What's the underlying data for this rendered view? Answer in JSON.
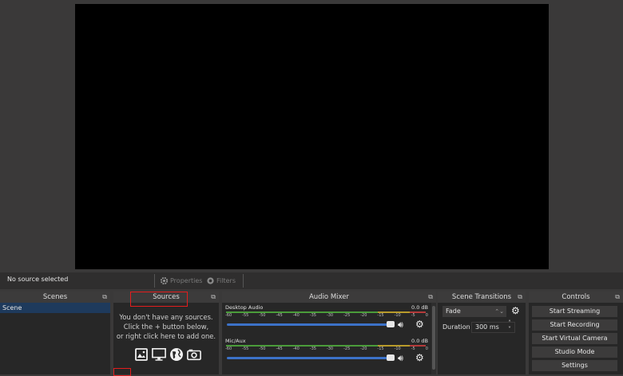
{
  "context_bar": {
    "status": "No source selected",
    "properties_label": "Properties",
    "filters_label": "Filters"
  },
  "scenes": {
    "title": "Scenes",
    "items": [
      "Scene"
    ]
  },
  "sources": {
    "title": "Sources",
    "empty_line1": "You don't have any sources.",
    "empty_line2": "Click the + button below,",
    "empty_line3": "or right click here to add one."
  },
  "mixer": {
    "title": "Audio Mixer",
    "tracks": [
      {
        "name": "Desktop Audio",
        "db": "0.0 dB",
        "volume": 1.0
      },
      {
        "name": "Mic/Aux",
        "db": "0.0 dB",
        "volume": 1.0
      }
    ],
    "tick_labels": [
      "-60",
      "-55",
      "-50",
      "-45",
      "-40",
      "-35",
      "-30",
      "-25",
      "-20",
      "-15",
      "-10",
      "-5",
      "0"
    ]
  },
  "transitions": {
    "title": "Scene Transitions",
    "selected": "Fade",
    "duration_label": "Duration",
    "duration_value": "300 ms"
  },
  "controls": {
    "title": "Controls",
    "buttons": {
      "stream": "Start Streaming",
      "record": "Start Recording",
      "virtual_cam": "Start Virtual Camera",
      "studio": "Studio Mode",
      "settings": "Settings"
    }
  },
  "colors": {
    "highlight": "#e31d1d",
    "selected_scene": "#1e3a5c",
    "volume_slider": "#3c72c8"
  }
}
